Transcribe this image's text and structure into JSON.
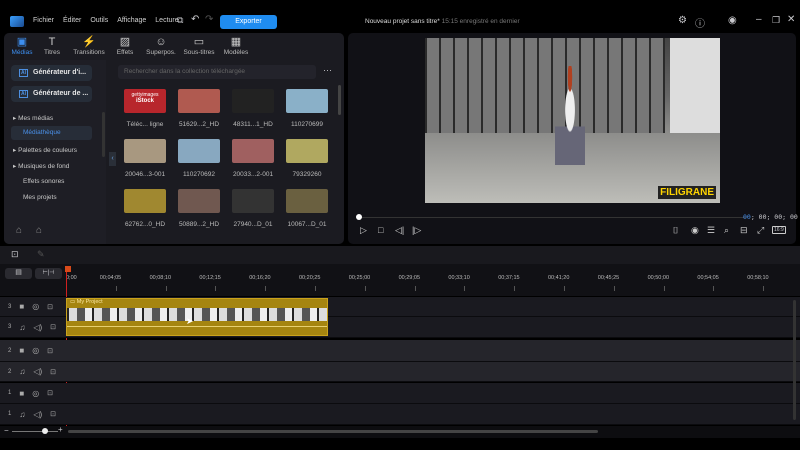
{
  "titlebar": {
    "menu": [
      "Fichier",
      "Éditer",
      "Outils",
      "Affichage",
      "Lecture"
    ],
    "export_label": "Exporter",
    "project_title": "Nouveau projet sans titre*",
    "saved_status": "15:15 enregistré en dernier"
  },
  "tabs": [
    {
      "label": "Médias",
      "icon": "media-icon"
    },
    {
      "label": "Titres",
      "icon": "title-icon"
    },
    {
      "label": "Transitions",
      "icon": "transition-icon"
    },
    {
      "label": "Effets",
      "icon": "effects-icon"
    },
    {
      "label": "Superpos.",
      "icon": "overlay-icon"
    },
    {
      "label": "Sous-titres",
      "icon": "subtitles-icon"
    },
    {
      "label": "Modèles",
      "icon": "templates-icon"
    }
  ],
  "sidebar": {
    "ai_buttons": [
      "Générateur d'i...",
      "Générateur de ..."
    ],
    "ai_badge": "AI",
    "items": [
      "Mes médias",
      "Médiathèque",
      "Palettes de couleurs",
      "Musiques de fond",
      "Effets sonores",
      "Mes projets"
    ]
  },
  "library": {
    "search_placeholder": "Rechercher dans la collection téléchargée",
    "getty_text": "gettyimages",
    "istock_text": "iStock",
    "items": [
      "Téléc... ligne",
      "51629...2_HD",
      "48311...1_HD",
      "110270699",
      "20046...3-001",
      "110270692",
      "20033...2-001",
      "79329260",
      "62762...0_HD",
      "50889...2_HD",
      "27940...D_01",
      "10067...D_01"
    ],
    "colors": [
      "#b8262c",
      "#b05a50",
      "#222",
      "#8ab0c8",
      "#a89880",
      "#88a8c0",
      "#a06060",
      "#b0a860",
      "#a08830",
      "#705850",
      "#333",
      "#6a6040"
    ]
  },
  "preview": {
    "watermark": "FILIGRANE",
    "timecode_hi": "00",
    "timecode": "; 00; 00; 00",
    "ratio": "16:9",
    "progress": 0
  },
  "timeline": {
    "ticks": [
      "0;00",
      "00;04;05",
      "00;08;10",
      "00;12;15",
      "00;16;20",
      "00;20;25",
      "00;25;00",
      "00;29;05",
      "00;33;10",
      "00;37;15",
      "00;41;20",
      "00;45;25",
      "00;50;00",
      "00;54;05",
      "00;58;10"
    ],
    "clip_title": "My Project",
    "track_numbers": [
      "3",
      "3",
      "2",
      "2",
      "1",
      "1"
    ]
  }
}
